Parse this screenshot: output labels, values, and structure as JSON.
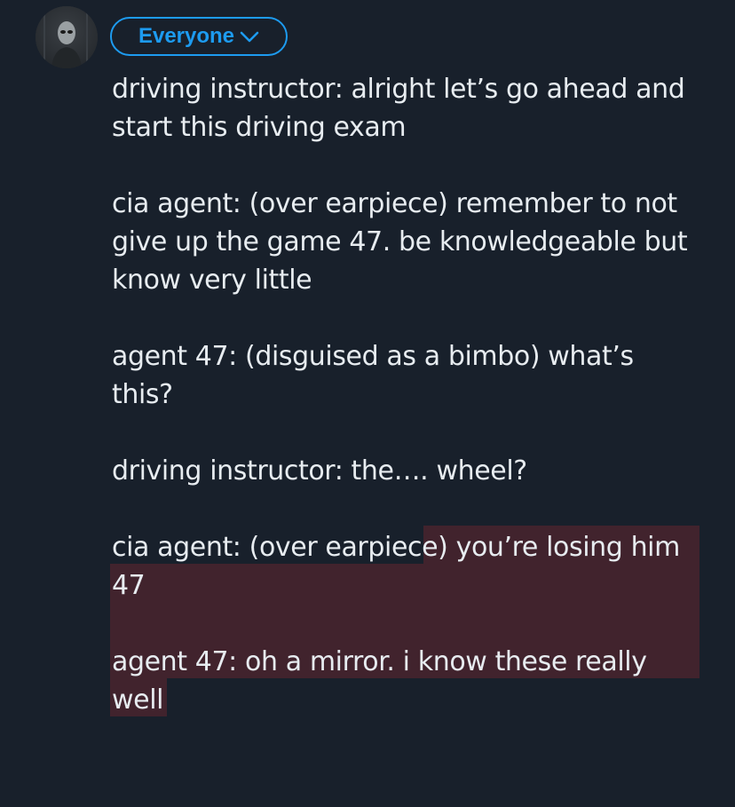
{
  "composer": {
    "audience_label": "Everyone",
    "avatar_alt": "profile avatar"
  },
  "tweet": {
    "paragraphs": [
      "driving instructor: alright let’s go ahead and start this driving exam",
      "cia agent: (over earpiece) remember to not give up the game 47. be knowledgeable but know very little",
      "agent 47: (disguised as a bimbo) what’s this?",
      "driving instructor: the…. wheel?",
      "cia agent: (over earpiece) you’re losing him 47",
      "agent 47: oh a mirror. i know these really well"
    ]
  },
  "colors": {
    "background": "#18202b",
    "accent": "#1d9bf0",
    "text": "#e7ecf0",
    "over_limit_highlight": "#41232d"
  },
  "icons": {
    "audience_dropdown": "chevron-down-icon"
  }
}
